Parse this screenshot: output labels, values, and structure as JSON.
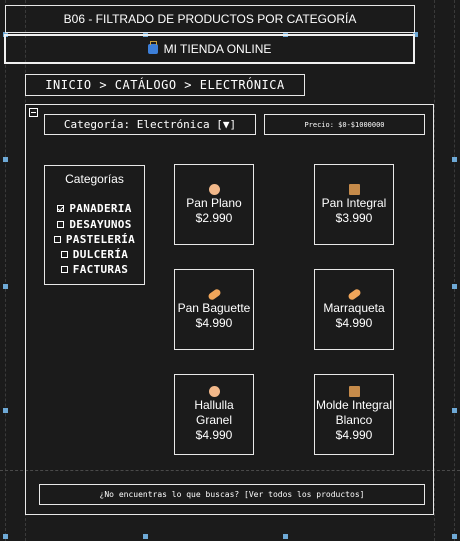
{
  "window": {
    "title": "B06 - FILTRADO DE PRODUCTOS POR CATEGORÍA"
  },
  "header": {
    "store_name": "MI TIENDA ONLINE",
    "store_icon": "shopping-bags-icon"
  },
  "breadcrumb": {
    "text": "INICIO > CATÁLOGO > ELECTRÓNICA"
  },
  "filters": {
    "category_select": "Categoría: Electrónica [▼]",
    "price": "Precio: $0-$1000000"
  },
  "categories": {
    "title": "Categorías",
    "items": [
      {
        "label": "PANADERIA",
        "checked": true
      },
      {
        "label": "DESAYUNOS",
        "checked": false
      },
      {
        "label": "PASTELERÍA",
        "checked": false
      },
      {
        "label": "DULCERÍA",
        "checked": false
      },
      {
        "label": "FACTURAS",
        "checked": false
      }
    ]
  },
  "products": [
    {
      "name": "Pan Plano",
      "price": "$2.990",
      "icon": "flatbread-icon"
    },
    {
      "name": "Pan Integral",
      "price": "$3.990",
      "icon": "package-icon"
    },
    {
      "name": "Pan Baguette",
      "price": "$4.990",
      "icon": "baguette-icon"
    },
    {
      "name": "Marraqueta",
      "price": "$4.990",
      "icon": "baguette-icon"
    },
    {
      "name": "Hallulla Granel",
      "price": "$4.990",
      "icon": "flatbread-icon"
    },
    {
      "name": "Molde Integral Blanco",
      "price": "$4.990",
      "icon": "package-icon"
    }
  ],
  "footer": {
    "text": "¿No encuentras lo que buscas? [Ver todos los productos]"
  }
}
